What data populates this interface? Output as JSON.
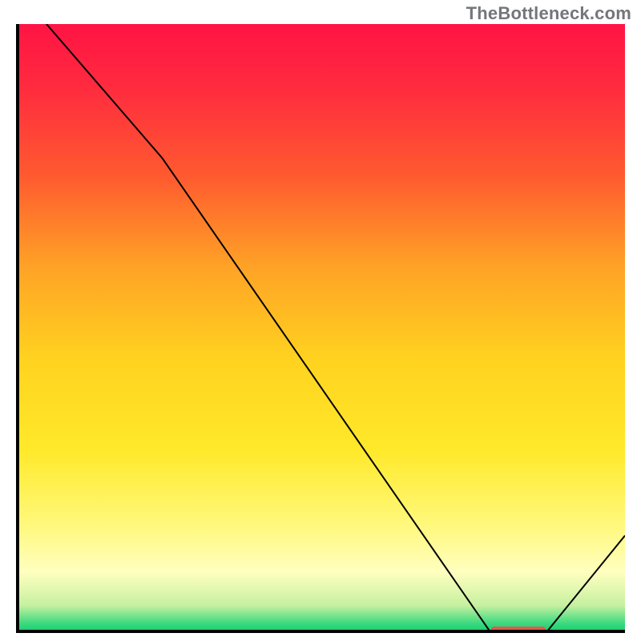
{
  "attribution": "TheBottleneck.com",
  "chart_data": {
    "type": "line",
    "title": "",
    "xlabel": "",
    "ylabel": "",
    "x_range": [
      0,
      100
    ],
    "y_range": [
      0,
      100
    ],
    "series": [
      {
        "name": "curve",
        "points": [
          {
            "x": 5,
            "y": 100
          },
          {
            "x": 24,
            "y": 78
          },
          {
            "x": 78,
            "y": 0
          },
          {
            "x": 87,
            "y": 0
          },
          {
            "x": 100,
            "y": 16
          }
        ],
        "stroke": "#000000",
        "stroke_width": 2
      }
    ],
    "marker_band": {
      "x_start": 78,
      "x_end": 87,
      "y": 0,
      "color": "#e05a4a",
      "thickness": 8
    },
    "gradient_stops": [
      {
        "offset": 0.0,
        "color": "#ff1444"
      },
      {
        "offset": 0.1,
        "color": "#ff2a3f"
      },
      {
        "offset": 0.25,
        "color": "#ff5a2f"
      },
      {
        "offset": 0.4,
        "color": "#ffa326"
      },
      {
        "offset": 0.55,
        "color": "#ffd21f"
      },
      {
        "offset": 0.7,
        "color": "#ffe92a"
      },
      {
        "offset": 0.82,
        "color": "#fff87a"
      },
      {
        "offset": 0.9,
        "color": "#ffffbf"
      },
      {
        "offset": 0.955,
        "color": "#c6f0a0"
      },
      {
        "offset": 0.985,
        "color": "#38d97e"
      },
      {
        "offset": 1.0,
        "color": "#18c96e"
      }
    ],
    "axes": {
      "show_ticks": false,
      "show_grid": false,
      "border": true
    }
  }
}
